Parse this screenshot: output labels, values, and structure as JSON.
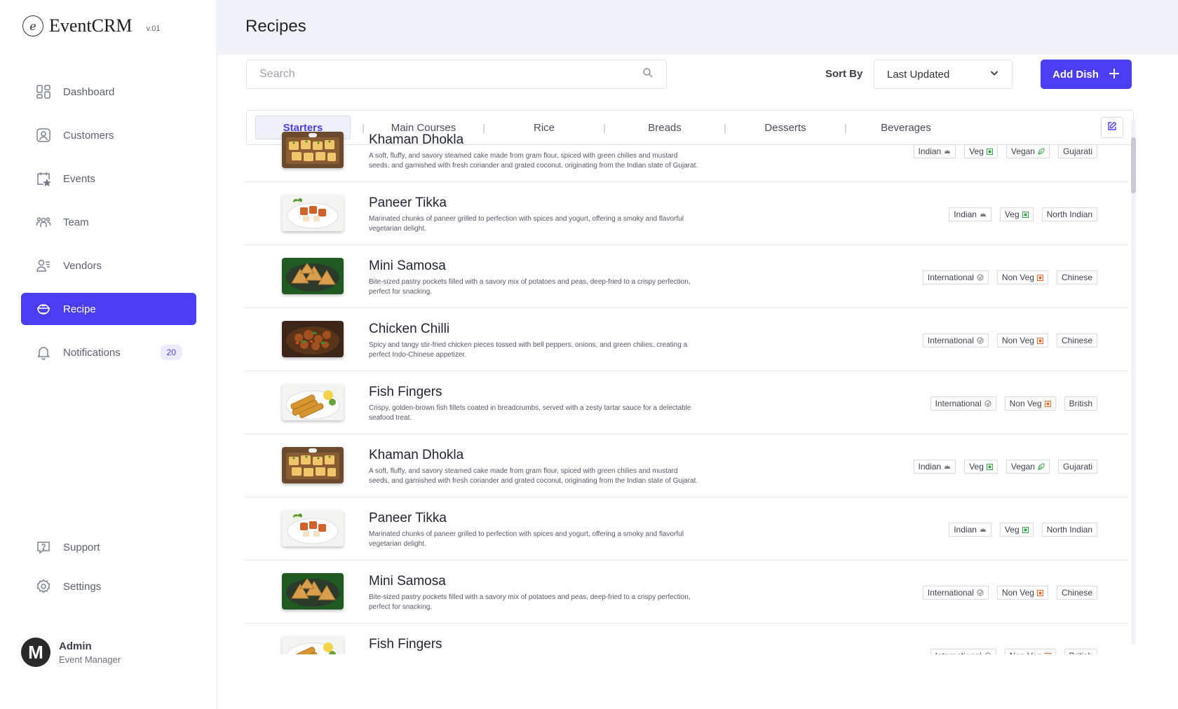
{
  "brand": {
    "name": "EventCRM",
    "version": "v.01",
    "logo_letter": "e"
  },
  "sidebar": {
    "items": [
      {
        "label": "Dashboard",
        "icon": "dashboard-icon"
      },
      {
        "label": "Customers",
        "icon": "customers-icon"
      },
      {
        "label": "Events",
        "icon": "events-icon"
      },
      {
        "label": "Team",
        "icon": "team-icon"
      },
      {
        "label": "Vendors",
        "icon": "vendors-icon"
      },
      {
        "label": "Recipe",
        "icon": "recipe-icon",
        "active": true
      },
      {
        "label": "Notifications",
        "icon": "bell-icon",
        "badge": "20"
      }
    ],
    "bottom": [
      {
        "label": "Support",
        "icon": "support-icon"
      },
      {
        "label": "Settings",
        "icon": "gear-icon"
      }
    ]
  },
  "user": {
    "initial": "M",
    "name": "Admin",
    "role": "Event Manager"
  },
  "page": {
    "title": "Recipes"
  },
  "search": {
    "placeholder": "Search",
    "value": ""
  },
  "sort": {
    "label": "Sort By",
    "selected": "Last Updated"
  },
  "add_button": {
    "label": "Add Dish",
    "icon": "plus-icon"
  },
  "tabs": [
    "Starters",
    "Main Courses",
    "Rice",
    "Breads",
    "Desserts",
    "Beverages"
  ],
  "active_tab": "Starters",
  "tag_separator": "|",
  "colors": {
    "accent": "#4b3ef0",
    "veg": "#3aa548",
    "nonveg": "#e46a2c"
  },
  "recipes": [
    {
      "name": "Khaman Dhokla",
      "desc": "A soft, fluffy, and savory steamed cake made from gram flour, spiced with green chilies and mustard seeds, and garnished with fresh coriander and grated coconut, originating from the Indian state of Gujarat.",
      "image": "dhokla",
      "tags": [
        {
          "label": "Indian",
          "icon": "india-icon"
        },
        {
          "label": "Veg",
          "icon": "veg-icon"
        },
        {
          "label": "Vegan",
          "icon": "leaf-icon"
        },
        {
          "label": "Gujarati",
          "icon": ""
        }
      ]
    },
    {
      "name": "Paneer Tikka",
      "desc": "Marinated chunks of paneer grilled to perfection with spices and yogurt, offering a smoky and flavorful vegetarian delight.",
      "image": "paneer",
      "tags": [
        {
          "label": "Indian",
          "icon": "india-icon"
        },
        {
          "label": "Veg",
          "icon": "veg-icon"
        },
        {
          "label": "North Indian",
          "icon": ""
        }
      ]
    },
    {
      "name": "Mini Samosa",
      "desc": "Bite-sized pastry pockets filled with a savory mix of potatoes and peas, deep-fried to a crispy perfection, perfect for snacking.",
      "image": "samosa",
      "tags": [
        {
          "label": "International",
          "icon": "globe-icon"
        },
        {
          "label": "Non Veg",
          "icon": "nonveg-icon"
        },
        {
          "label": "Chinese",
          "icon": ""
        }
      ]
    },
    {
      "name": "Chicken Chilli",
      "desc": "Spicy and tangy stir-fried chicken pieces tossed with bell peppers, onions, and green chilies, creating a perfect Indo-Chinese appetizer.",
      "image": "chilli",
      "tags": [
        {
          "label": "International",
          "icon": "globe-icon"
        },
        {
          "label": "Non Veg",
          "icon": "nonveg-icon"
        },
        {
          "label": "Chinese",
          "icon": ""
        }
      ]
    },
    {
      "name": "Fish Fingers",
      "desc": "Crispy, golden-brown fish fillets coated in breadcrumbs, served with a zesty tartar sauce for a delectable seafood treat.",
      "image": "fish",
      "tags": [
        {
          "label": "International",
          "icon": "globe-icon"
        },
        {
          "label": "Non Veg",
          "icon": "nonveg-icon"
        },
        {
          "label": "British",
          "icon": ""
        }
      ]
    },
    {
      "name": "Khaman Dhokla",
      "desc": "A soft, fluffy, and savory steamed cake made from gram flour, spiced with green chilies and mustard seeds, and garnished with fresh coriander and grated coconut, originating from the Indian state of Gujarat.",
      "image": "dhokla",
      "tags": [
        {
          "label": "Indian",
          "icon": "india-icon"
        },
        {
          "label": "Veg",
          "icon": "veg-icon"
        },
        {
          "label": "Vegan",
          "icon": "leaf-icon"
        },
        {
          "label": "Gujarati",
          "icon": ""
        }
      ]
    },
    {
      "name": "Paneer Tikka",
      "desc": "Marinated chunks of paneer grilled to perfection with spices and yogurt, offering a smoky and flavorful vegetarian delight.",
      "image": "paneer",
      "tags": [
        {
          "label": "Indian",
          "icon": "india-icon"
        },
        {
          "label": "Veg",
          "icon": "veg-icon"
        },
        {
          "label": "North Indian",
          "icon": ""
        }
      ]
    },
    {
      "name": "Mini Samosa",
      "desc": "Bite-sized pastry pockets filled with a savory mix of potatoes and peas, deep-fried to a crispy perfection, perfect for snacking.",
      "image": "samosa",
      "tags": [
        {
          "label": "International",
          "icon": "globe-icon"
        },
        {
          "label": "Non Veg",
          "icon": "nonveg-icon"
        },
        {
          "label": "Chinese",
          "icon": ""
        }
      ]
    },
    {
      "name": "Fish Fingers",
      "desc": "",
      "image": "fish",
      "tags": [
        {
          "label": "International",
          "icon": "globe-icon"
        },
        {
          "label": "Non Veg",
          "icon": "nonveg-icon"
        },
        {
          "label": "British",
          "icon": ""
        }
      ]
    }
  ]
}
